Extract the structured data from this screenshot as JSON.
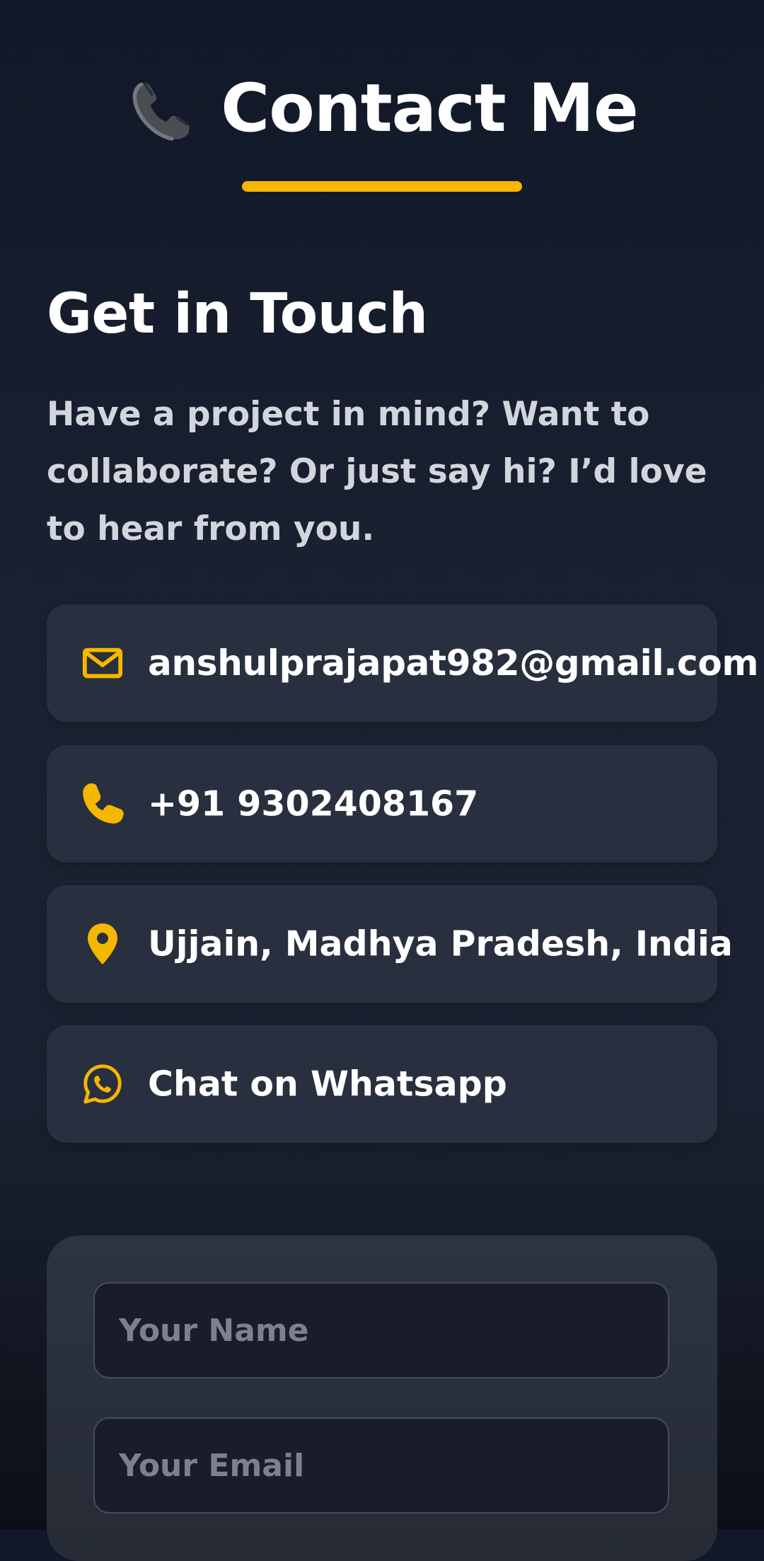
{
  "header": {
    "title": "Contact Me",
    "icon": "telephone-receiver-icon",
    "accent_color": "#f5b700"
  },
  "section": {
    "title": "Get in Touch",
    "intro": "Have a project in mind? Want to collaborate? Or just say hi? I’d love to hear from you."
  },
  "contact": {
    "email": {
      "icon": "mail-icon",
      "value": "anshulprajapat982@gmail.com"
    },
    "phone": {
      "icon": "phone-icon",
      "value": "+91 9302408167"
    },
    "location": {
      "icon": "map-pin-icon",
      "value": "Ujjain, Madhya Pradesh, India"
    },
    "whatsapp": {
      "icon": "whatsapp-icon",
      "value": "Chat on Whatsapp"
    }
  },
  "form": {
    "name_placeholder": "Your Name",
    "email_placeholder": "Your Email"
  }
}
